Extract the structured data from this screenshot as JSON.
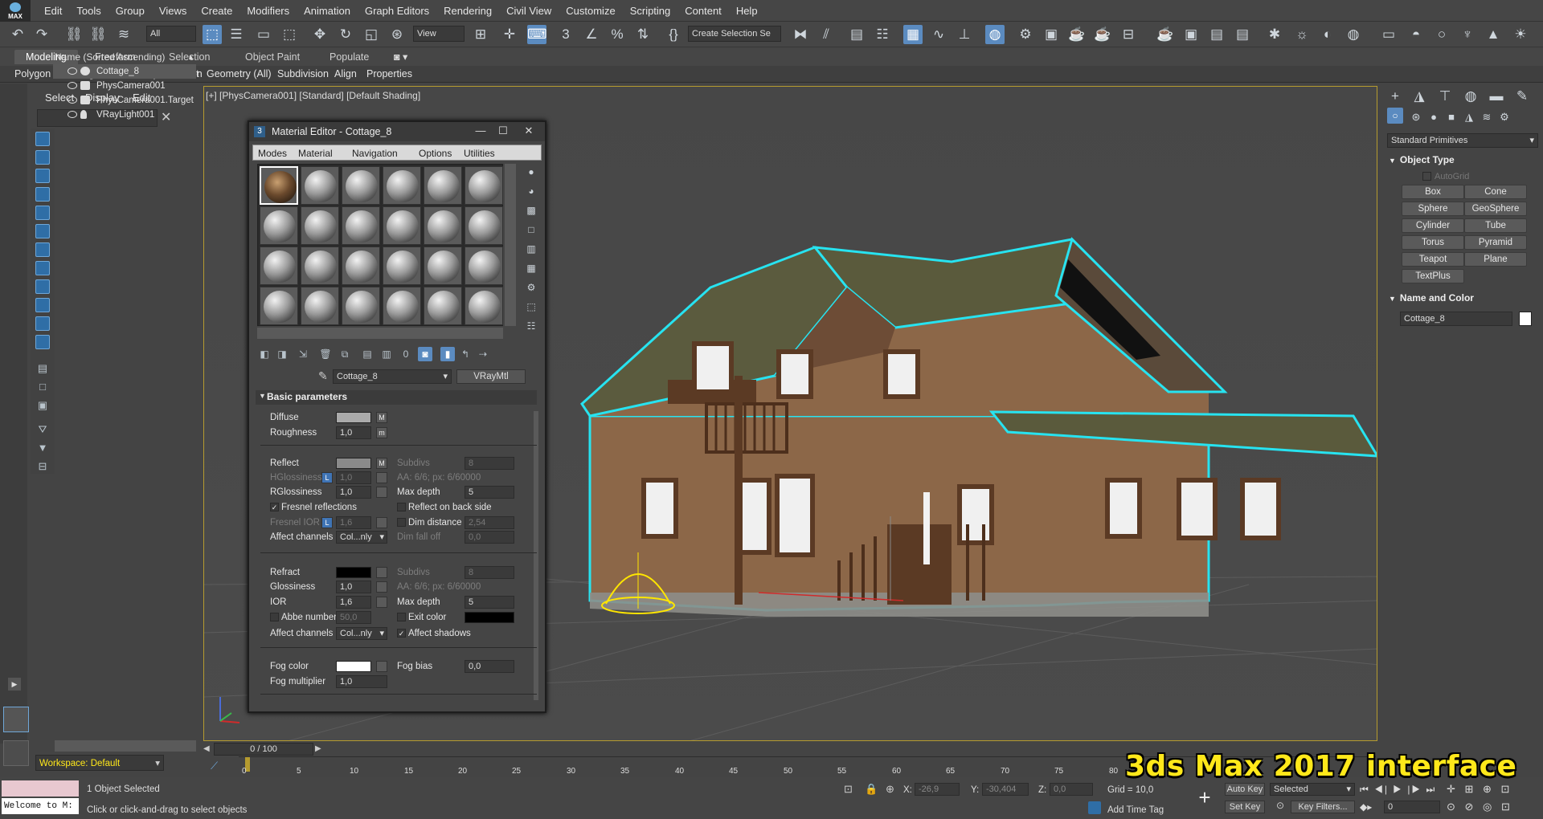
{
  "app": {
    "logo_text": "MAX"
  },
  "menu": [
    "Edit",
    "Tools",
    "Group",
    "Views",
    "Create",
    "Modifiers",
    "Animation",
    "Graph Editors",
    "Rendering",
    "Civil View",
    "Customize",
    "Scripting",
    "Content",
    "Help"
  ],
  "toolbar": {
    "filter": "All",
    "ref_coord": "View",
    "selection_set": "Create Selection Se"
  },
  "ribbon": {
    "tabs": [
      "Modeling",
      "Freeform",
      "Selection",
      "Object Paint",
      "Populate"
    ],
    "items": [
      "Polygon Modeling",
      "Modify Selection",
      "Edit",
      "Geometry (All)",
      "Subdivision",
      "Align",
      "Properties"
    ]
  },
  "scene_explorer": {
    "tabs": [
      "Select",
      "Display",
      "Edit"
    ],
    "search_placeholder": "",
    "column": "Name (Sorted Ascending)",
    "rows": [
      "Cottage_8",
      "PhysCamera001",
      "PhysCamera001.Target",
      "VRayLight001"
    ]
  },
  "viewport": {
    "label": "[+] [PhysCamera001] [Standard] [Default Shading]"
  },
  "material_editor": {
    "title": "Material Editor - Cottage_8",
    "badge": "3",
    "menu": [
      "Modes",
      "Material",
      "Navigation",
      "Options",
      "Utilities"
    ],
    "material_name": "Cottage_8",
    "material_type": "VRayMtl",
    "rollout": "Basic parameters",
    "diffuse": {
      "label": "Diffuse",
      "m": "M"
    },
    "roughness": {
      "label": "Roughness",
      "value": "1,0",
      "m": "m"
    },
    "reflect": {
      "label": "Reflect",
      "m": "M"
    },
    "hglossiness": {
      "label": "HGlossiness",
      "lock": "L",
      "value": "1,0"
    },
    "rglossiness": {
      "label": "RGlossiness",
      "value": "1,0"
    },
    "fresnel": {
      "label": "Fresnel reflections",
      "check": "✓"
    },
    "fresnel_ior": {
      "label": "Fresnel IOR",
      "lock": "L",
      "value": "1,6"
    },
    "affect_channels": {
      "label": "Affect channels",
      "value": "Col...nly"
    },
    "subdivs": {
      "label": "Subdivs",
      "value": "8"
    },
    "aa": "AA: 6/6; px: 6/60000",
    "max_depth": {
      "label": "Max depth",
      "value": "5"
    },
    "reflect_back": "Reflect on back side",
    "dim_distance": {
      "label": "Dim distance",
      "value": "2,54"
    },
    "dim_falloff": {
      "label": "Dim fall off",
      "value": "0,0"
    },
    "refract": {
      "label": "Refract"
    },
    "glossiness": {
      "label": "Glossiness",
      "value": "1,0"
    },
    "ior": {
      "label": "IOR",
      "value": "1,6"
    },
    "abbe": {
      "label": "Abbe number",
      "value": "50,0"
    },
    "affect_channels2": {
      "label": "Affect channels",
      "value": "Col...nly"
    },
    "subdivs2": {
      "label": "Subdivs",
      "value": "8"
    },
    "aa2": "AA: 6/6; px: 6/60000",
    "max_depth2": {
      "label": "Max depth",
      "value": "5"
    },
    "exit_color": "Exit color",
    "affect_shadows": {
      "label": "Affect shadows",
      "check": "✓"
    },
    "fog_color": "Fog color",
    "fog_bias": {
      "label": "Fog bias",
      "value": "0,0"
    },
    "fog_multiplier": {
      "label": "Fog multiplier",
      "value": "1,0"
    }
  },
  "command_panel": {
    "dropdown": "Standard Primitives",
    "object_type_title": "Object Type",
    "autogrid": "AutoGrid",
    "buttons": [
      "Box",
      "Cone",
      "Sphere",
      "GeoSphere",
      "Cylinder",
      "Tube",
      "Torus",
      "Pyramid",
      "Teapot",
      "Plane",
      "TextPlus"
    ],
    "name_color_title": "Name and Color",
    "object_name": "Cottage_8"
  },
  "timeline": {
    "frame": "0 / 100",
    "ticks": [
      "0",
      "5",
      "10",
      "15",
      "20",
      "25",
      "30",
      "35",
      "40",
      "45",
      "50",
      "55",
      "60",
      "65",
      "70",
      "75",
      "80"
    ]
  },
  "status": {
    "selected": "1 Object Selected",
    "prompt": "Click or click-and-drag to select objects",
    "welcome": "Welcome to M:",
    "workspace": "Workspace: Default",
    "x_label": "X:",
    "x": "-26,9",
    "y_label": "Y:",
    "y": "-30,404",
    "z_label": "Z:",
    "z": "0,0",
    "grid": "Grid = 10,0",
    "add_time_tag": "Add Time Tag",
    "auto_key": "Auto Key",
    "set_key": "Set Key",
    "selected_set": "Selected",
    "key_filters": "Key Filters...",
    "frame_field": "0"
  },
  "banner": "3ds Max 2017 interface",
  "colors": {
    "accent": "#5b8bc0",
    "selection_outline": "#27e3f0",
    "viewport_border": "#b59b2f",
    "banner": "#ffe81a"
  }
}
